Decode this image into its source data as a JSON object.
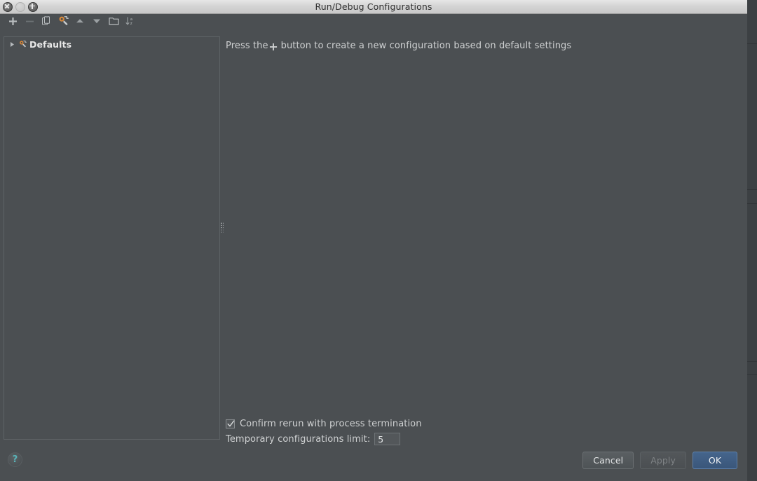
{
  "window": {
    "title": "Run/Debug Configurations",
    "controls": [
      {
        "name": "close",
        "label": "Close"
      },
      {
        "name": "minimize",
        "label": "Minimize"
      },
      {
        "name": "zoom",
        "label": "Zoom"
      }
    ]
  },
  "toolbar": {
    "items": [
      {
        "name": "add-configuration-button",
        "icon": "plus-icon",
        "label": "Add New Configuration",
        "enabled": true
      },
      {
        "name": "remove-configuration-button",
        "icon": "minus-icon",
        "label": "Remove Configuration",
        "enabled": false
      },
      {
        "name": "copy-configuration-button",
        "icon": "copy-icon",
        "label": "Copy Configuration",
        "enabled": true
      },
      {
        "name": "edit-defaults-button",
        "icon": "wrench-icon",
        "label": "Edit defaults",
        "enabled": true
      },
      {
        "name": "move-up-button",
        "icon": "arrow-up-icon",
        "label": "Move Up",
        "enabled": true
      },
      {
        "name": "move-down-button",
        "icon": "arrow-down-icon",
        "label": "Move Down",
        "enabled": true
      },
      {
        "name": "create-folder-button",
        "icon": "folder-icon",
        "label": "Create New Folder",
        "enabled": true
      },
      {
        "name": "sort-configurations-button",
        "icon": "sort-az-icon",
        "label": "Sort Configurations",
        "enabled": true
      }
    ]
  },
  "tree": {
    "nodes": [
      {
        "name": "tree-node-defaults",
        "label": "Defaults",
        "icon": "wrench-icon",
        "expanded": false
      }
    ]
  },
  "main": {
    "hint_prefix": "Press the",
    "hint_icon": "plus-icon",
    "hint_suffix": "button to create a new configuration based on default settings"
  },
  "options": {
    "confirm_rerun": {
      "label": "Confirm rerun with process termination",
      "checked": true
    },
    "temp_limit": {
      "label": "Temporary configurations limit:",
      "value": "5"
    }
  },
  "footer": {
    "help_label": "?",
    "buttons": [
      {
        "name": "cancel-button",
        "label": "Cancel",
        "style": "normal"
      },
      {
        "name": "apply-button",
        "label": "Apply",
        "style": "disabled"
      },
      {
        "name": "ok-button",
        "label": "OK",
        "style": "primary"
      }
    ]
  },
  "colors": {
    "dialog_bg": "#4b4f52",
    "titlebar_bg": "#d3d3d3",
    "accent_blue": "#45658c",
    "icon_orange": "#d8893b",
    "help_teal": "#59b3b8",
    "text": "#cfd1d2"
  }
}
